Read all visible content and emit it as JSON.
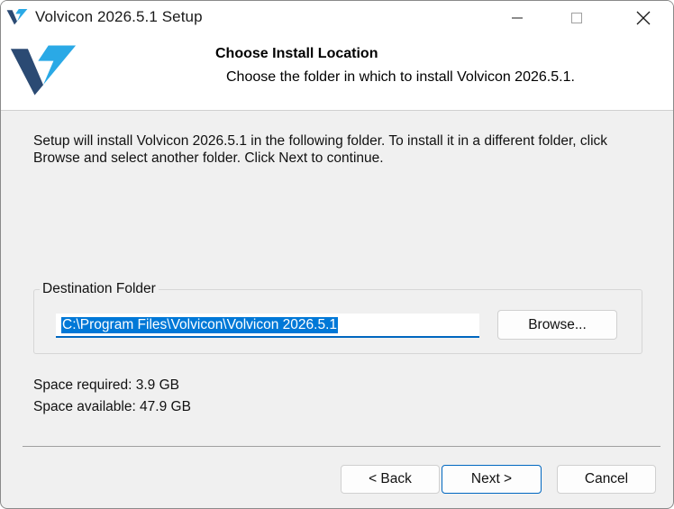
{
  "window": {
    "title": "Volvicon 2026.5.1 Setup",
    "controls": [
      "minimize",
      "maximize",
      "close"
    ]
  },
  "header": {
    "title": "Choose Install Location",
    "subtitle": "Choose the folder in which to install Volvicon 2026.5.1."
  },
  "body": {
    "instructions": "Setup will install Volvicon 2026.5.1 in the following folder. To install it in a different folder, click Browse and select another folder. Click Next to continue."
  },
  "destination": {
    "group_label": "Destination Folder",
    "path": "C:\\Program Files\\Volvicon\\Volvicon 2026.5.1",
    "browse_label": "Browse..."
  },
  "space": {
    "required": "Space required: 3.9 GB",
    "available": "Space available: 47.9 GB"
  },
  "footer": {
    "back_label": "< Back",
    "next_label": "Next >",
    "cancel_label": "Cancel"
  },
  "colors": {
    "logo_dark": "#2b4a73",
    "logo_light": "#2aa9e6",
    "selection": "#0078d7",
    "accent": "#0067c0"
  },
  "icons": {
    "title": "volvicon-logo-icon",
    "header": "volvicon-logo-icon",
    "minimize": "minimize-icon",
    "maximize": "maximize-icon",
    "close": "close-icon"
  }
}
